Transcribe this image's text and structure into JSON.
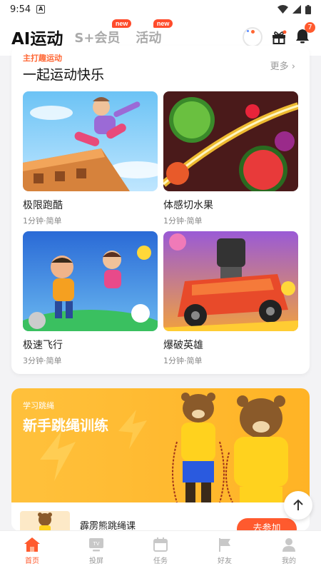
{
  "status": {
    "time": "9:54",
    "a_icon": "A"
  },
  "header": {
    "tab_main": "AI运动",
    "tab_vip": "S+会员",
    "tab_activity": "活动",
    "new_badge_1": "new",
    "new_badge_2": "new",
    "notification_count": "7"
  },
  "section": {
    "tag": "主打趣运动",
    "title": "一起运动快乐",
    "more": "更多"
  },
  "games": [
    {
      "name": "极限跑酷",
      "meta": "1分钟·简单"
    },
    {
      "name": "体感切水果",
      "meta": "1分钟·简单"
    },
    {
      "name": "极速飞行",
      "meta": "3分钟·简单"
    },
    {
      "name": "爆破英雄",
      "meta": "1分钟·简单"
    }
  ],
  "jump": {
    "sub": "学习跳绳",
    "title": "新手跳绳训练",
    "course_name": "霹雳熊跳绳课",
    "join": "去参加"
  },
  "nav": [
    {
      "label": "首页",
      "icon": "home-icon"
    },
    {
      "label": "投屏",
      "icon": "tv-icon"
    },
    {
      "label": "任务",
      "icon": "calendar-icon"
    },
    {
      "label": "好友",
      "icon": "flag-icon"
    },
    {
      "label": "我的",
      "icon": "person-icon"
    }
  ],
  "colors": {
    "accent": "#ff5a2e",
    "banner": "#ffb325"
  }
}
